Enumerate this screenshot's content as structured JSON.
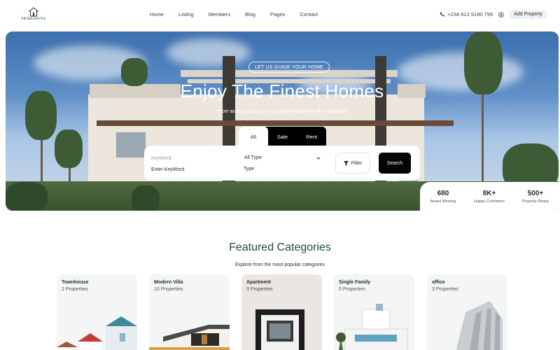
{
  "brand": {
    "name": "PRIMEHAVEN"
  },
  "nav": {
    "items": [
      "Home",
      "Listing",
      "Members",
      "Blog",
      "Pages",
      "Contact"
    ],
    "phone": "+234 812 9190 795",
    "add_property": "Add Property"
  },
  "hero": {
    "tag": "LET US GUIDE YOUR HOME",
    "title": "Enjoy The Finest Homes",
    "subtitle": "From as low as $10 per day with limited time offer discounts"
  },
  "search": {
    "tabs": [
      {
        "label": "All",
        "active": true
      },
      {
        "label": "Sale",
        "active": false
      },
      {
        "label": "Rent",
        "active": false
      }
    ],
    "keyword_label": "KeyWord",
    "keyword_value": "Enter KeyWord",
    "type_label": "All Type",
    "type_value": "Type",
    "filter_label": "Filter",
    "search_label": "Search"
  },
  "stats": [
    {
      "value": "680",
      "label": "Award Winning"
    },
    {
      "value": "8K+",
      "label": "Happy Customers"
    },
    {
      "value": "500+",
      "label": "Property Ready"
    }
  ],
  "categories": {
    "title": "Featured Categories",
    "subtitle": "Explore from the most popular categories",
    "items": [
      {
        "name": "Townhouse",
        "count": "2 Properties"
      },
      {
        "name": "Modern Villa",
        "count": "10 Properties"
      },
      {
        "name": "Apartment",
        "count": "3 Properties"
      },
      {
        "name": "Single Family",
        "count": "5 Properties"
      },
      {
        "name": "office",
        "count": "3 Properties"
      }
    ]
  },
  "colors": {
    "accent_dark": "#050505",
    "heading_green": "#24463f",
    "card_bg": "#f4f6f5"
  }
}
